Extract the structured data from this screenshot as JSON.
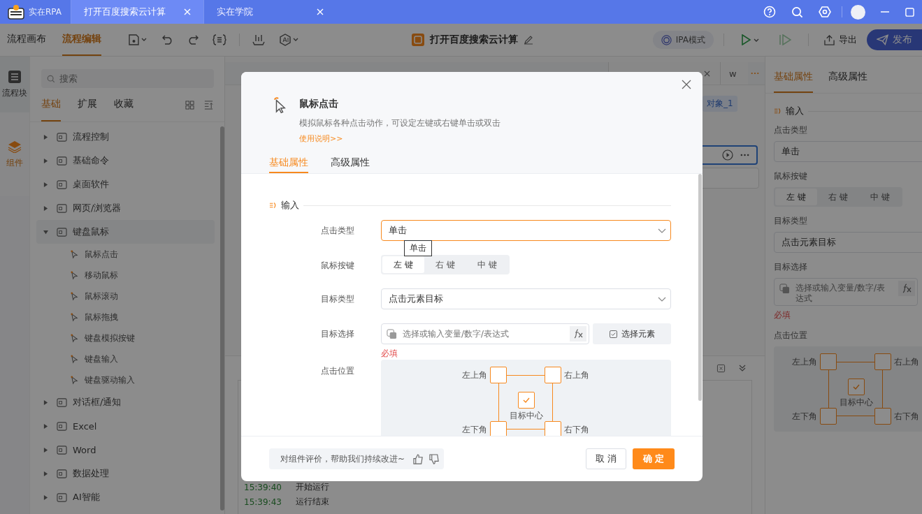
{
  "title_bar": {
    "app_name": "实在RPA",
    "tabs": [
      {
        "label": "打开百度搜索云计算",
        "selected": true
      },
      {
        "label": "实在学院",
        "selected": false
      }
    ]
  },
  "toolbar": {
    "modes": [
      {
        "label": "流程画布",
        "selected": false
      },
      {
        "label": "流程编辑",
        "selected": true
      }
    ],
    "document_title": "打开百度搜索云计算",
    "ipa_mode": "IPA模式",
    "export": "导出",
    "publish": "发布"
  },
  "rail": [
    {
      "label": "流程块",
      "selected": false
    },
    {
      "label": "组件",
      "selected": true
    }
  ],
  "sidebar": {
    "search_placeholder": "搜索",
    "tabs": [
      {
        "label": "基础",
        "selected": true
      },
      {
        "label": "扩展",
        "selected": false
      },
      {
        "label": "收藏",
        "selected": false
      }
    ],
    "tree": [
      {
        "label": "流程控制",
        "expanded": false
      },
      {
        "label": "基础命令",
        "expanded": false
      },
      {
        "label": "桌面软件",
        "expanded": false
      },
      {
        "label": "网页/浏览器",
        "expanded": false
      },
      {
        "label": "键盘鼠标",
        "expanded": true,
        "children": [
          {
            "label": "鼠标点击"
          },
          {
            "label": "移动鼠标"
          },
          {
            "label": "鼠标滚动"
          },
          {
            "label": "鼠标拖拽"
          },
          {
            "label": "键盘模拟按键"
          },
          {
            "label": "键盘输入"
          },
          {
            "label": "键盘驱动输入"
          }
        ]
      },
      {
        "label": "对话框/通知",
        "expanded": false
      },
      {
        "label": "Excel",
        "expanded": false
      },
      {
        "label": "Word",
        "expanded": false
      },
      {
        "label": "数据处理",
        "expanded": false
      },
      {
        "label": "AI智能",
        "expanded": false
      }
    ]
  },
  "canvas": {
    "last_tab": "w",
    "variable_chip": "对象_1",
    "log": [
      {
        "time": "15:39:40",
        "message": "开始运行"
      },
      {
        "time": "15:39:43",
        "message": "运行结束"
      }
    ]
  },
  "properties": {
    "tabs": [
      {
        "label": "基础属性",
        "selected": true
      },
      {
        "label": "高级属性",
        "selected": false
      }
    ],
    "section": "输入",
    "fields": [
      {
        "kind": "select",
        "label": "点击类型",
        "value": "单击",
        "focused": false
      },
      {
        "kind": "segmented",
        "label": "鼠标按键",
        "options": [
          {
            "label": "左 键",
            "selected": true
          },
          {
            "label": "右 键",
            "selected": false
          },
          {
            "label": "中 键",
            "selected": false
          }
        ]
      },
      {
        "kind": "select",
        "label": "目标类型",
        "value": "点击元素目标",
        "focused": false
      },
      {
        "kind": "expression",
        "label": "目标选择",
        "placeholder": "选择或输入变量/数字/表达式",
        "error": "必填"
      },
      {
        "kind": "position",
        "label": "点击位置",
        "corners": [
          {
            "label": "左上角",
            "selected": false
          },
          {
            "label": "右上角",
            "selected": false
          },
          {
            "label": "左下角",
            "selected": false
          },
          {
            "label": "右下角",
            "selected": false
          }
        ],
        "center": {
          "label": "目标中心",
          "selected": true
        }
      }
    ]
  },
  "dialog": {
    "title": "鼠标点击",
    "description": "模拟鼠标各种点击动作，可设定左键或右键单击或双击",
    "help_link": "使用说明>>",
    "tabs": [
      {
        "label": "基础属性",
        "selected": true
      },
      {
        "label": "高级属性",
        "selected": false
      }
    ],
    "section": "输入",
    "fields": [
      {
        "kind": "select",
        "label": "点击类型",
        "value": "单击",
        "focused": true,
        "tooltip": "单击"
      },
      {
        "kind": "segmented",
        "label": "鼠标按键",
        "options": [
          {
            "label": "左 键",
            "selected": true
          },
          {
            "label": "右 键",
            "selected": false
          },
          {
            "label": "中 键",
            "selected": false
          }
        ]
      },
      {
        "kind": "select",
        "label": "目标类型",
        "value": "点击元素目标",
        "focused": false
      },
      {
        "kind": "expression",
        "label": "目标选择",
        "placeholder": "选择或输入变量/数字/表达式",
        "button": "选择元素",
        "error": "必填"
      },
      {
        "kind": "position",
        "label": "点击位置",
        "corners": [
          {
            "label": "左上角",
            "selected": false
          },
          {
            "label": "右上角",
            "selected": false
          },
          {
            "label": "左下角",
            "selected": false
          },
          {
            "label": "右下角",
            "selected": false
          }
        ],
        "center": {
          "label": "目标中心",
          "selected": true
        }
      }
    ],
    "feedback": "对组件评价，帮助我们持续改进~",
    "cancel": "取消",
    "ok": "确定"
  }
}
